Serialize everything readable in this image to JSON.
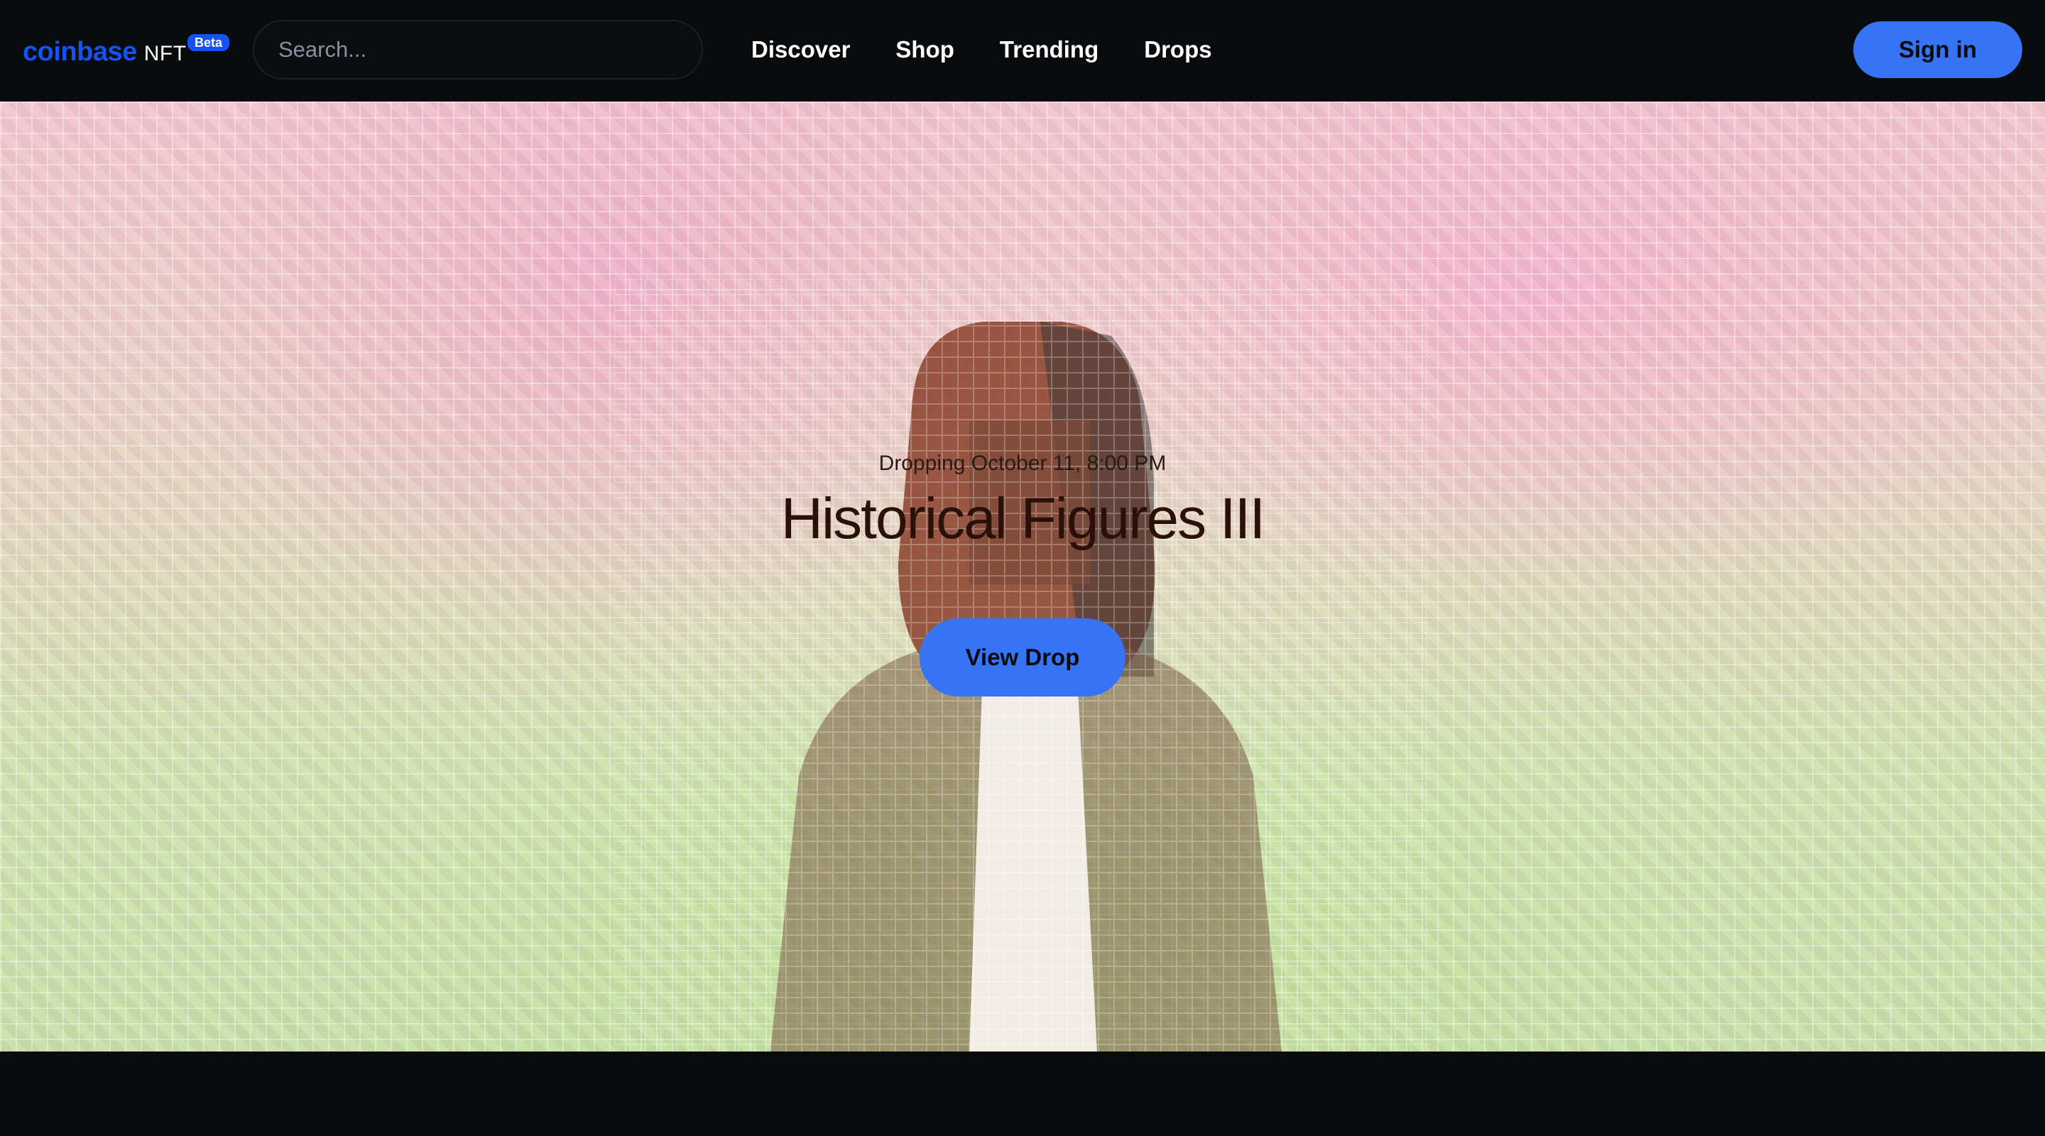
{
  "header": {
    "logo_word": "coinbase",
    "logo_suffix": "NFT",
    "beta_badge": "Beta",
    "search_placeholder": "Search...",
    "nav": [
      {
        "label": "Discover"
      },
      {
        "label": "Shop"
      },
      {
        "label": "Trending"
      },
      {
        "label": "Drops"
      }
    ],
    "signin_label": "Sign in"
  },
  "hero": {
    "drop_date": "Dropping October 11, 8:00 PM",
    "title": "Historical Figures III",
    "cta_label": "View Drop"
  },
  "colors": {
    "background": "#0a0b0d",
    "brand_blue": "#1652f0",
    "button_blue": "#3773f5"
  }
}
